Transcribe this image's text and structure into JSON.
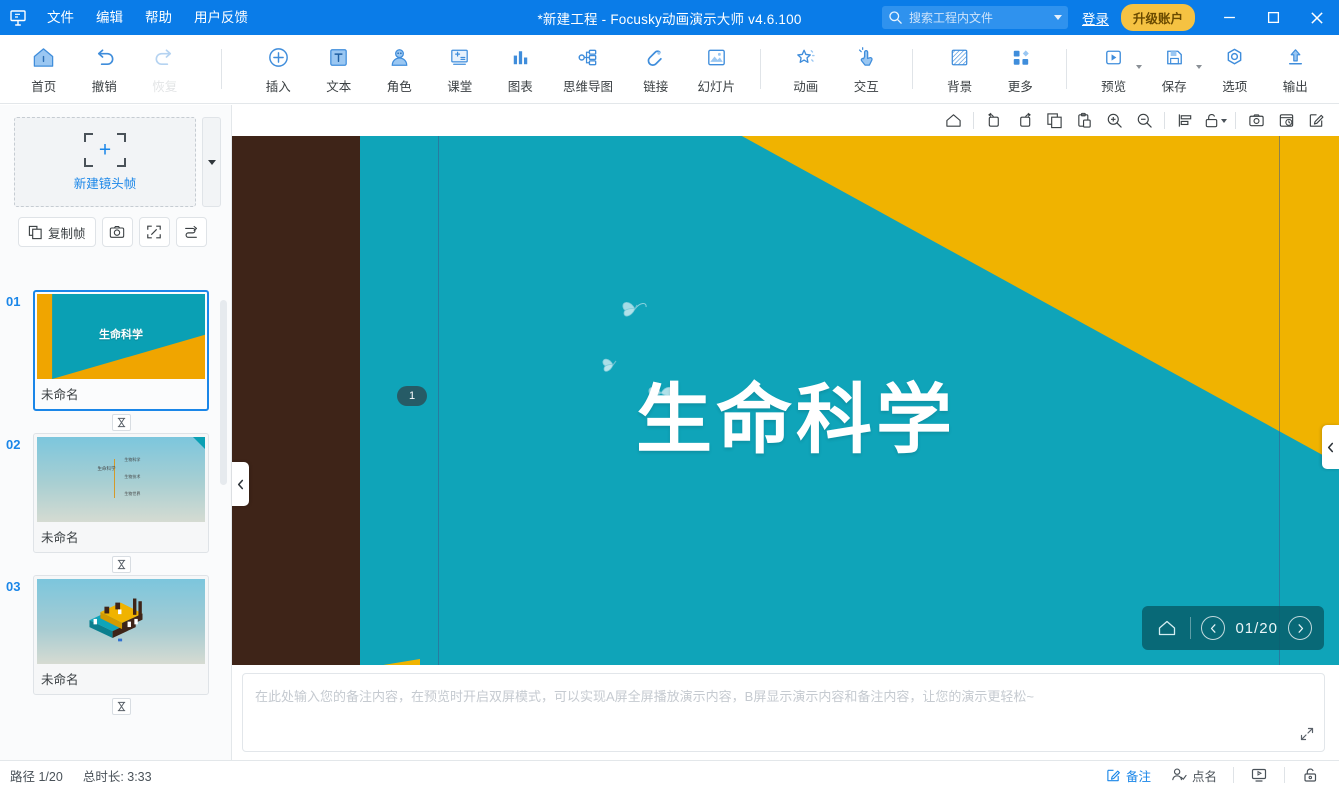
{
  "titlebar": {
    "logo_icon": "focusky-logo-icon",
    "menus": [
      {
        "label": "文件",
        "name": "menu-file"
      },
      {
        "label": "编辑",
        "name": "menu-edit"
      },
      {
        "label": "帮助",
        "name": "menu-help"
      },
      {
        "label": "用户反馈",
        "name": "menu-feedback"
      }
    ],
    "title": "*新建工程 - Focusky动画演示大师  v4.6.100",
    "search_placeholder": "搜索工程内文件",
    "login_label": "登录",
    "upgrade_label": "升级账户",
    "minimize_label": "—",
    "maximize_label": "□",
    "close_label": "×",
    "bg_color": "#0a7ce8",
    "upgrade_color": "#f5c242"
  },
  "ribbon": {
    "groups": [
      {
        "items": [
          {
            "label": "首页",
            "icon": "home-icon",
            "name": "ribbon-home",
            "disabled": false
          },
          {
            "label": "撤销",
            "icon": "undo-icon",
            "name": "ribbon-undo",
            "disabled": false
          },
          {
            "label": "恢复",
            "icon": "redo-icon",
            "name": "ribbon-redo",
            "disabled": true
          }
        ]
      },
      {
        "items": [
          {
            "label": "插入",
            "icon": "plus-circle-icon",
            "name": "ribbon-insert",
            "disabled": false
          },
          {
            "label": "文本",
            "icon": "text-box-icon",
            "name": "ribbon-text",
            "disabled": false
          },
          {
            "label": "角色",
            "icon": "person-icon",
            "name": "ribbon-role",
            "disabled": false
          },
          {
            "label": "课堂",
            "icon": "classroom-icon",
            "name": "ribbon-classroom",
            "disabled": false
          },
          {
            "label": "图表",
            "icon": "bar-chart-icon",
            "name": "ribbon-chart",
            "disabled": false
          },
          {
            "label": "思维导图",
            "icon": "mindmap-icon",
            "name": "ribbon-mindmap",
            "disabled": false
          },
          {
            "label": "链接",
            "icon": "link-paperclip-icon",
            "name": "ribbon-link",
            "disabled": false
          },
          {
            "label": "幻灯片",
            "icon": "slide-image-icon",
            "name": "ribbon-slide",
            "disabled": false
          }
        ]
      },
      {
        "items": [
          {
            "label": "动画",
            "icon": "star-sparkle-icon",
            "name": "ribbon-animation",
            "disabled": false
          },
          {
            "label": "交互",
            "icon": "hand-click-icon",
            "name": "ribbon-interaction",
            "disabled": false
          }
        ]
      },
      {
        "items": [
          {
            "label": "背景",
            "icon": "background-hatch-icon",
            "name": "ribbon-background",
            "disabled": false
          },
          {
            "label": "更多",
            "icon": "grid-more-icon",
            "name": "ribbon-more",
            "disabled": false
          }
        ]
      },
      {
        "items": [
          {
            "label": "预览",
            "icon": "play-preview-icon",
            "name": "ribbon-preview",
            "disabled": false,
            "caret": true
          },
          {
            "label": "保存",
            "icon": "save-disk-icon",
            "name": "ribbon-save",
            "disabled": false,
            "caret": true
          },
          {
            "label": "选项",
            "icon": "options-gear-icon",
            "name": "ribbon-options",
            "disabled": false
          },
          {
            "label": "输出",
            "icon": "export-upload-icon",
            "name": "ribbon-export",
            "disabled": false
          }
        ]
      }
    ]
  },
  "left_panel": {
    "new_frame_label": "新建镜头帧",
    "new_frame_icon": "add-frame-icon",
    "dropdown_icon": "chevron-down-icon",
    "tools": [
      {
        "label": "复制帧",
        "icon": "copy-frame-icon",
        "name": "copy-frame-button",
        "square": false
      },
      {
        "label": "",
        "icon": "camera-icon",
        "name": "capture-frame-button",
        "square": true
      },
      {
        "label": "",
        "icon": "fit-frame-icon",
        "name": "fit-frame-button",
        "square": true
      },
      {
        "label": "",
        "icon": "reorder-path-icon",
        "name": "reorder-path-button",
        "square": true
      }
    ],
    "slides": [
      {
        "num": "01",
        "name": "未命名",
        "selected": true,
        "thumb": "title-slide",
        "title_text": "生命科学"
      },
      {
        "num": "02",
        "name": "未命名",
        "selected": false,
        "thumb": "outline-slide",
        "left_label": "生命科学",
        "right_labels": [
          "生物科学",
          "生物技术",
          "生物世界"
        ]
      },
      {
        "num": "03",
        "name": "未命名",
        "selected": false,
        "thumb": "iso-factory-slide"
      }
    ],
    "transition_icon": "transition-hourglass-icon"
  },
  "canvas_toolbar": {
    "buttons": [
      {
        "icon": "home-outline-icon",
        "name": "canvas-home-button",
        "sep_after": true
      },
      {
        "icon": "rotate-left-icon",
        "name": "rotate-left-button",
        "sep_after": false
      },
      {
        "icon": "rotate-right-icon",
        "name": "rotate-right-button",
        "sep_after": false
      },
      {
        "icon": "duplicate-icon",
        "name": "duplicate-button",
        "sep_after": false
      },
      {
        "icon": "paste-icon",
        "name": "paste-button",
        "sep_after": false
      },
      {
        "icon": "zoom-in-icon",
        "name": "zoom-in-button",
        "sep_after": false
      },
      {
        "icon": "zoom-out-icon",
        "name": "zoom-out-button",
        "sep_after": true
      },
      {
        "icon": "align-icon",
        "name": "align-button",
        "sep_after": false
      },
      {
        "icon": "unlock-icon",
        "name": "lock-button",
        "sep_after": false,
        "caret": true
      },
      {
        "icon": "snapshot-icon",
        "name": "snapshot-button",
        "sep_after": false
      },
      {
        "icon": "history-icon",
        "name": "history-button",
        "sep_after": false
      },
      {
        "icon": "edit-pencil-icon",
        "name": "edit-button",
        "sep_after": false
      }
    ]
  },
  "stage": {
    "slide_title": "生命科学",
    "frame_badge": "1",
    "colors": {
      "brown": "#3e2418",
      "teal": "#0fa4b9",
      "yellow": "#f0b300"
    },
    "nav": {
      "home_icon": "home-outline-icon",
      "prev_icon": "chevron-left-icon",
      "next_icon": "chevron-right-icon",
      "counter": "01/20"
    },
    "collapse_left_icon": "chevron-left-icon",
    "collapse_right_icon": "chevron-left-icon"
  },
  "notes": {
    "placeholder": "在此处输入您的备注内容，在预览时开启双屏模式，可以实现A屏全屏播放演示内容，B屏显示演示内容和备注内容，让您的演示更轻松~",
    "value": "",
    "expand_icon": "expand-diagonal-icon"
  },
  "statusbar": {
    "path_label": "路径 1/20",
    "duration_label": "总时长: 3:33",
    "buttons": [
      {
        "label": "备注",
        "icon": "note-pencil-icon",
        "name": "status-notes-button",
        "accent": true
      },
      {
        "label": "点名",
        "icon": "roll-call-icon",
        "name": "status-rollcall-button",
        "accent": false
      },
      {
        "label": "",
        "icon": "present-screen-icon",
        "name": "status-present-button",
        "accent": false
      },
      {
        "label": "",
        "icon": "lock-status-icon",
        "name": "status-lock-button",
        "accent": false
      }
    ],
    "accent_color": "#1a86e8"
  }
}
